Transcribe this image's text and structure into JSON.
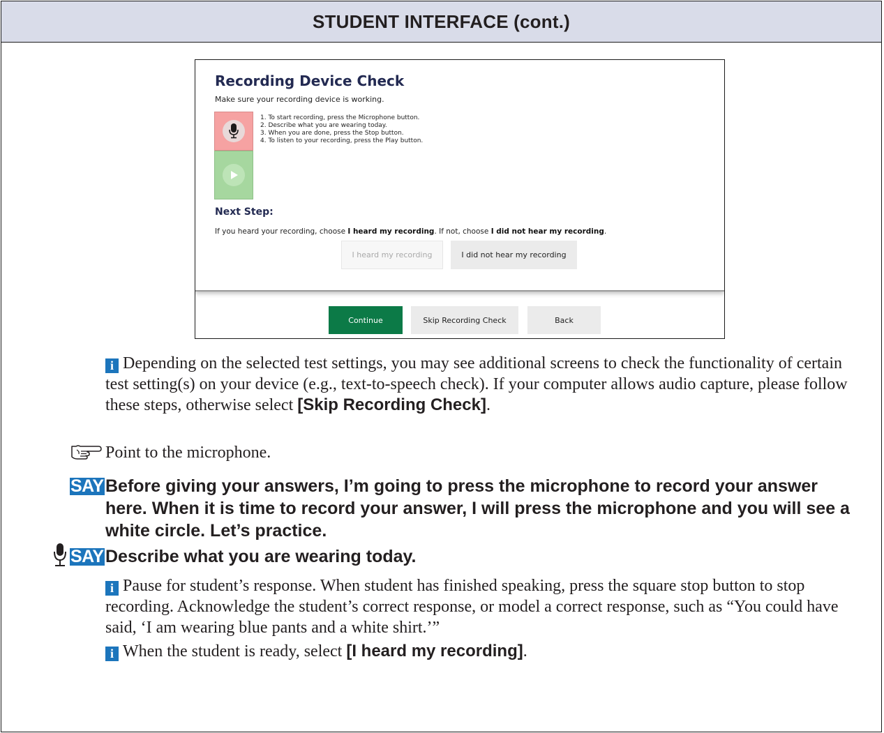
{
  "header": {
    "title": "STUDENT INTERFACE (cont.)"
  },
  "screenshot": {
    "title": "Recording Device Check",
    "subtitle": "Make sure your recording device is working.",
    "steps": [
      "1. To start recording, press the Microphone button.",
      "2. Describe what you are wearing today.",
      "3. When you are done, press the Stop button.",
      "4. To listen to your recording, press the Play button."
    ],
    "next_step_heading": "Next Step:",
    "next_text": {
      "part1": "If you heard your recording, choose ",
      "bold1": "I heard my recording",
      "part2": ". If not, choose ",
      "bold2": "I did not hear my recording",
      "part3": "."
    },
    "heard_button": "I heard my recording",
    "not_heard_button": "I did not hear my recording",
    "continue_button": "Continue",
    "skip_button": "Skip Recording Check",
    "back_button": "Back"
  },
  "notes": {
    "info_glyph": "i",
    "note1": {
      "text": "Depending on the selected test settings, you may see additional screens to check the functionality of certain test setting(s) on your device (e.g., text-to-speech check). If your computer allows audio capture, please follow these steps, otherwise select ",
      "bold": "[Skip Recording Check]",
      "end": "."
    },
    "point_text": "Point to the microphone.",
    "say_label": "SAY",
    "say1": "Before giving your answers, I’m going to press the microphone to record your answer here. When it is time to record your answer, I will press the microphone and you will see a white circle. Let’s practice.",
    "say2": "Describe what you are wearing today.",
    "note2": "Pause for student’s response. When student has finished speaking, press the square stop button to stop recording. Acknowledge the student’s correct response, or model a correct response, such as “You could have said, ‘I am wearing blue pants and a white shirt.’”",
    "note3": {
      "text": "When the student is ready, select ",
      "bold": "[I heard my recording]",
      "end": "."
    }
  },
  "colors": {
    "header_bg": "#d9dce9",
    "say_bg": "#1c75bc",
    "continue_bg": "#0c7a47",
    "mic_bg": "#f6a2a2",
    "play_bg": "#a6d79f"
  }
}
